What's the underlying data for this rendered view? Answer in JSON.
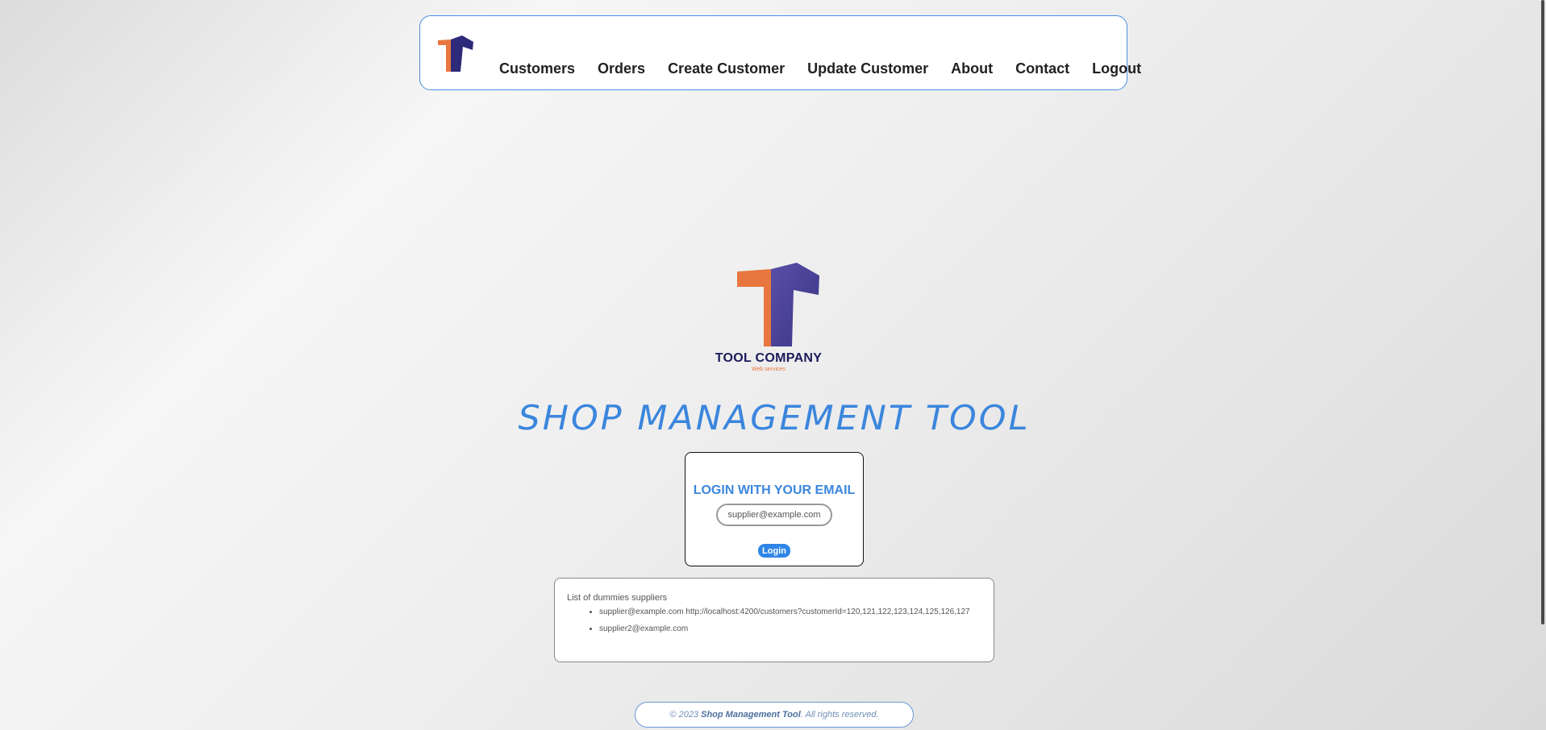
{
  "nav": {
    "logo_icon": "tool-company-logo-icon",
    "links": [
      {
        "label": "Customers"
      },
      {
        "label": "Orders"
      },
      {
        "label": "Create Customer"
      },
      {
        "label": "Update Customer"
      },
      {
        "label": "About"
      },
      {
        "label": "Contact"
      },
      {
        "label": "Logout"
      }
    ]
  },
  "brand": {
    "logo_icon": "tool-company-logo-icon",
    "company_name": "TOOL COMPANY",
    "tagline": "Web services",
    "colors": {
      "orange": "#e8773f",
      "purple": "#3e3a8a",
      "navy": "#1c1a5a",
      "accent_blue": "#3b86dd"
    }
  },
  "main": {
    "title": "SHOP MANAGEMENT TOOL"
  },
  "login": {
    "heading": "LOGIN WITH YOUR EMAIL",
    "email_placeholder": "supplier@example.com",
    "email_value": "",
    "button_label": "Login"
  },
  "suppliers": {
    "title": "List of dummies suppliers",
    "items": [
      "supplier@example.com http://localhost:4200/customers?customerId=120,121,122,123,124,125,126,127",
      "supplier2@example.com"
    ]
  },
  "footer": {
    "prefix": "© 2023 ",
    "app_name": "Shop Management Tool",
    "suffix": ". All rights reserved."
  }
}
